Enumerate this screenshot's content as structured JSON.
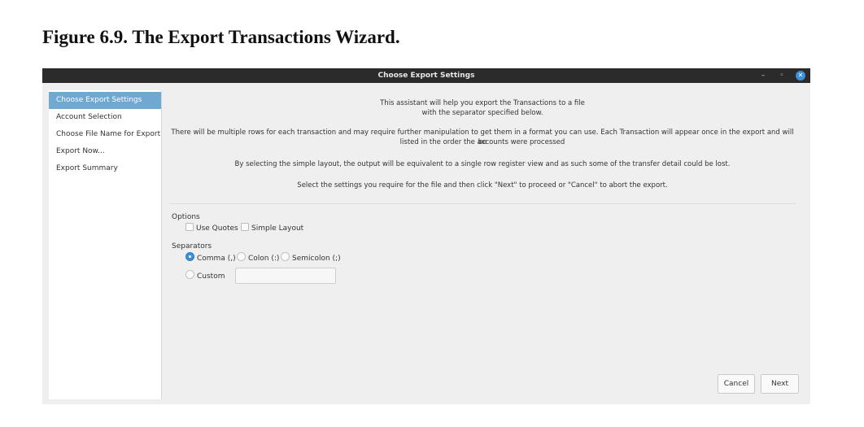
{
  "figure": {
    "caption": "Figure 6.9. The Export Transactions Wizard."
  },
  "window": {
    "title": "Choose Export Settings",
    "controls": {
      "minimize": "–",
      "maximize": "◦",
      "close": "✕"
    }
  },
  "sidebar": {
    "items": [
      {
        "label": "Choose Export Settings",
        "active": true
      },
      {
        "label": "Account Selection"
      },
      {
        "label": "Choose File Name for Export"
      },
      {
        "label": "Export Now..."
      },
      {
        "label": "Export Summary"
      }
    ]
  },
  "intro": {
    "line1a": "This assistant will help you export the Transactions to a file",
    "line1b": "with the separator specified below.",
    "line2a": "There will be multiple rows for each transaction and may require further manipulation to get them in a format you can use. Each Transaction will appear once in the export and will be",
    "line2b": "listed in the order the accounts were processed",
    "line3": "By selecting the simple layout, the output will be equivalent to a single row register view and as such some of the transfer detail could be lost.",
    "line4": "Select the settings you require for the file and then click \"Next\" to proceed or \"Cancel\" to abort the export."
  },
  "options": {
    "label": "Options",
    "use_quotes": "Use Quotes",
    "simple_layout": "Simple Layout"
  },
  "separators": {
    "label": "Separators",
    "comma": "Comma (,)",
    "colon": "Colon (:)",
    "semicolon": "Semicolon (;)",
    "custom": "Custom",
    "custom_value": "",
    "selected": "comma"
  },
  "buttons": {
    "cancel": "Cancel",
    "next": "Next"
  },
  "colors": {
    "titlebar": "#2b2b2b",
    "accent": "#3d8fd6",
    "sidebar_active": "#6fa9d2",
    "window_bg": "#efefef"
  }
}
